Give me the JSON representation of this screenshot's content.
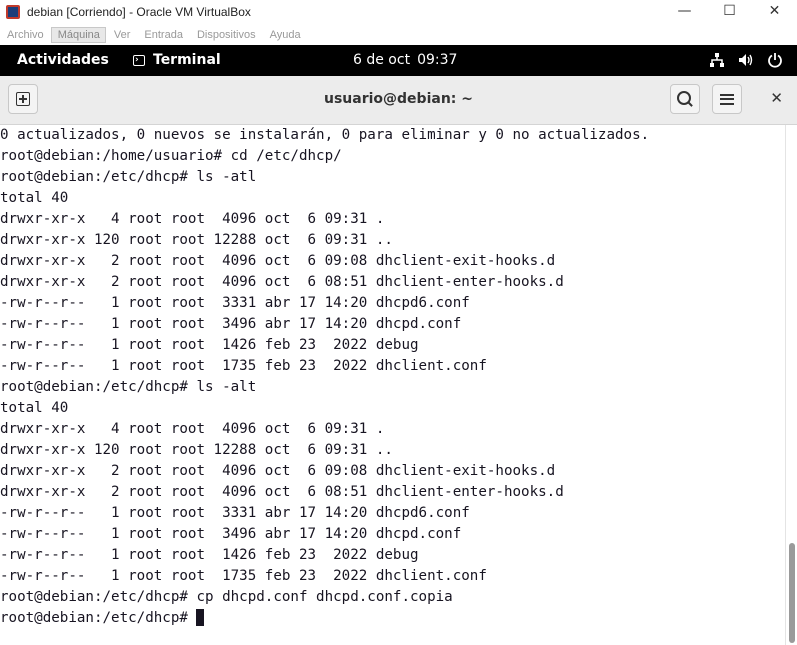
{
  "host_window": {
    "title": "debian [Corriendo] - Oracle VM VirtualBox",
    "controls": {
      "minimize": "—",
      "maximize": "☐",
      "close": "✕"
    }
  },
  "vbox_menu": {
    "items": [
      "Archivo",
      "Máquina",
      "Ver",
      "Entrada",
      "Dispositivos",
      "Ayuda"
    ],
    "active": "Máquina"
  },
  "gnome_topbar": {
    "activities": "Actividades",
    "app_name": "Terminal",
    "date": "6 de oct",
    "time": "09:37",
    "tray_icons": [
      "network-icon",
      "volume-icon",
      "power-icon"
    ]
  },
  "terminal_header": {
    "title": "usuario@debian: ~",
    "close": "✕"
  },
  "terminal": {
    "lines": [
      "0 actualizados, 0 nuevos se instalarán, 0 para eliminar y 0 no actualizados.",
      "root@debian:/home/usuario# cd /etc/dhcp/",
      "root@debian:/etc/dhcp# ls -atl",
      "total 40",
      "drwxr-xr-x   4 root root  4096 oct  6 09:31 .",
      "drwxr-xr-x 120 root root 12288 oct  6 09:31 ..",
      "drwxr-xr-x   2 root root  4096 oct  6 09:08 dhclient-exit-hooks.d",
      "drwxr-xr-x   2 root root  4096 oct  6 08:51 dhclient-enter-hooks.d",
      "-rw-r--r--   1 root root  3331 abr 17 14:20 dhcpd6.conf",
      "-rw-r--r--   1 root root  3496 abr 17 14:20 dhcpd.conf",
      "-rw-r--r--   1 root root  1426 feb 23  2022 debug",
      "-rw-r--r--   1 root root  1735 feb 23  2022 dhclient.conf",
      "root@debian:/etc/dhcp# ls -alt",
      "total 40",
      "drwxr-xr-x   4 root root  4096 oct  6 09:31 .",
      "drwxr-xr-x 120 root root 12288 oct  6 09:31 ..",
      "drwxr-xr-x   2 root root  4096 oct  6 09:08 dhclient-exit-hooks.d",
      "drwxr-xr-x   2 root root  4096 oct  6 08:51 dhclient-enter-hooks.d",
      "-rw-r--r--   1 root root  3331 abr 17 14:20 dhcpd6.conf",
      "-rw-r--r--   1 root root  3496 abr 17 14:20 dhcpd.conf",
      "-rw-r--r--   1 root root  1426 feb 23  2022 debug",
      "-rw-r--r--   1 root root  1735 feb 23  2022 dhclient.conf",
      "root@debian:/etc/dhcp# cp dhcpd.conf dhcpd.conf.copia"
    ],
    "prompt": "root@debian:/etc/dhcp# "
  }
}
